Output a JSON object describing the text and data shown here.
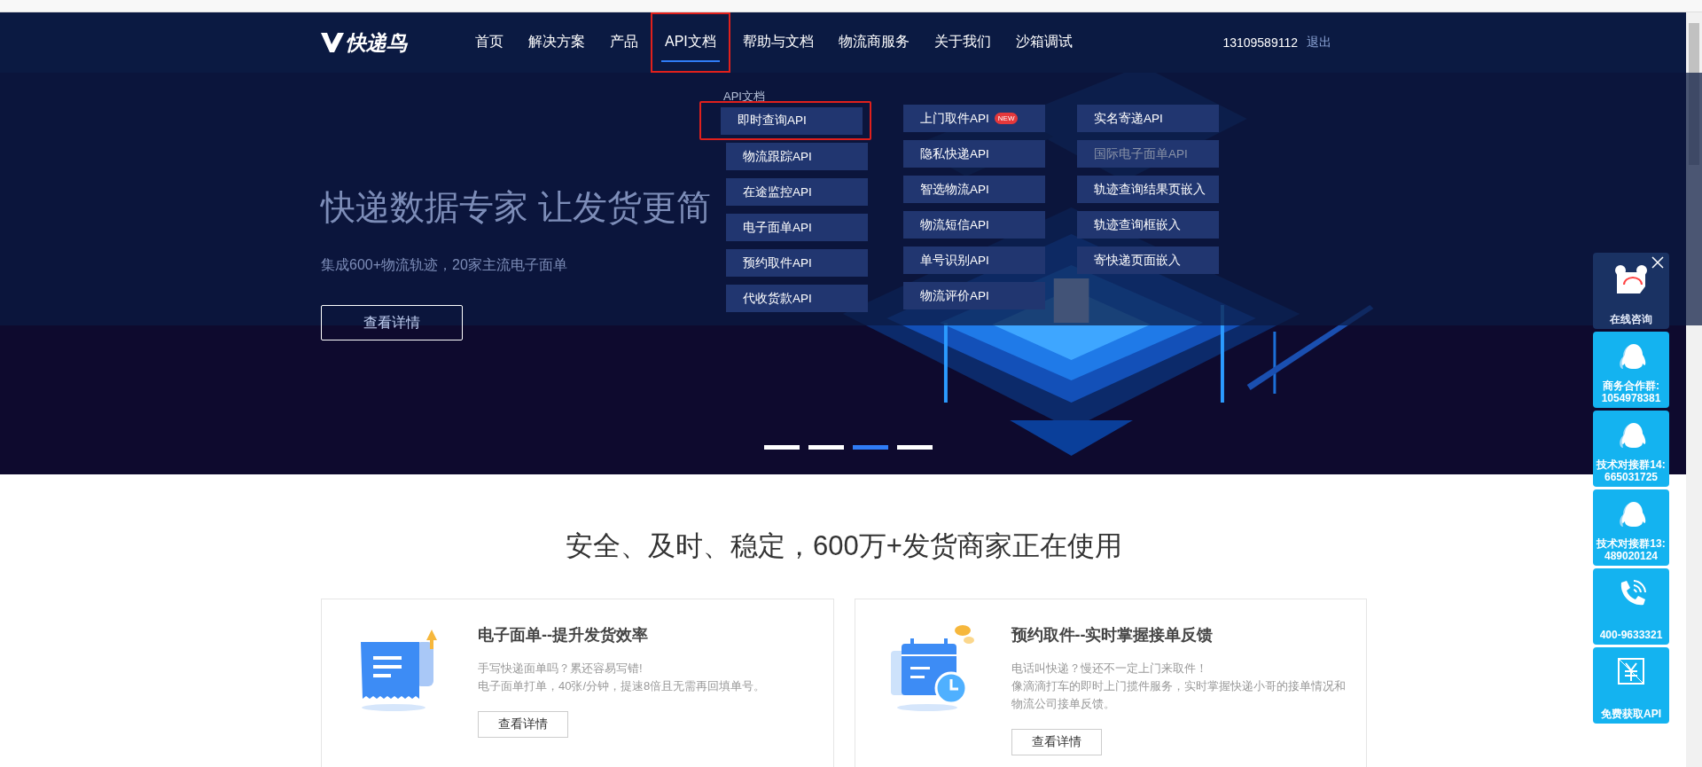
{
  "nav": {
    "logo": "快递鸟",
    "items": [
      {
        "label": "首页",
        "selected": false,
        "marked": false
      },
      {
        "label": "解决方案",
        "selected": false,
        "marked": false
      },
      {
        "label": "产品",
        "selected": false,
        "marked": false
      },
      {
        "label": "API文档",
        "selected": true,
        "marked": true
      },
      {
        "label": "帮助与文档",
        "selected": false,
        "marked": false
      },
      {
        "label": "物流商服务",
        "selected": false,
        "marked": false
      },
      {
        "label": "关于我们",
        "selected": false,
        "marked": false
      },
      {
        "label": "沙箱调试",
        "selected": false,
        "marked": false
      }
    ],
    "phone": "13109589112",
    "logout": "退出"
  },
  "api_menu": {
    "heading": "API文档",
    "columns": [
      [
        {
          "label": "即时查询API",
          "disabled": false,
          "marked": true
        },
        {
          "label": "物流跟踪API",
          "disabled": false,
          "marked": false
        },
        {
          "label": "在途监控API",
          "disabled": false,
          "marked": false
        },
        {
          "label": "电子面单API",
          "disabled": false,
          "marked": false
        },
        {
          "label": "预约取件API",
          "disabled": false,
          "marked": false
        },
        {
          "label": "代收货款API",
          "disabled": false,
          "marked": false
        }
      ],
      [
        {
          "label": "上门取件API",
          "badge": "NEW",
          "disabled": false,
          "marked": false
        },
        {
          "label": "隐私快递API",
          "disabled": false,
          "marked": false
        },
        {
          "label": "智选物流API",
          "disabled": false,
          "marked": false
        },
        {
          "label": "物流短信API",
          "disabled": false,
          "marked": false
        },
        {
          "label": "单号识别API",
          "disabled": false,
          "marked": false
        },
        {
          "label": "物流评价API",
          "disabled": false,
          "marked": false
        }
      ],
      [
        {
          "label": "实名寄递API",
          "disabled": false,
          "marked": false
        },
        {
          "label": "国际电子面单API",
          "disabled": true,
          "marked": false
        },
        {
          "label": "轨迹查询结果页嵌入",
          "disabled": false,
          "marked": false
        },
        {
          "label": "轨迹查询框嵌入",
          "disabled": false,
          "marked": false
        },
        {
          "label": "寄快递页面嵌入",
          "disabled": false,
          "marked": false
        }
      ]
    ]
  },
  "banner": {
    "headline": "快递数据专家 让发货更简",
    "subtitle": "集成600+物流轨迹，20家主流电子面单",
    "button": "查看详情",
    "slides": [
      {
        "selected": false
      },
      {
        "selected": false
      },
      {
        "selected": true
      },
      {
        "selected": false
      }
    ]
  },
  "side_widgets": [
    {
      "kind": "chat",
      "title": "在线咨询"
    },
    {
      "kind": "qq",
      "title": "商务合作群:",
      "number": "1054978381"
    },
    {
      "kind": "qq",
      "title": "技术对接群14:",
      "number": "665031725"
    },
    {
      "kind": "qq",
      "title": "技术对接群13:",
      "number": "489020124"
    },
    {
      "kind": "phone",
      "title": "400-9633321"
    },
    {
      "kind": "price",
      "title": "免费获取API"
    }
  ],
  "section": {
    "heading": "安全、及时、稳定，600万+发货商家正在使用",
    "cards": [
      {
        "kind": "waybill",
        "title": "电子面单--提升发货效率",
        "lines": [
          "手写快递面单吗？累还容易写错!",
          "电子面单打单，40张/分钟，提速8倍且无需再回填单号。"
        ],
        "button": "查看详情"
      },
      {
        "kind": "calendar",
        "title": "预约取件--实时掌握接单反馈",
        "lines": [
          "电话叫快递？慢还不一定上门来取件！",
          "像滴滴打车的即时上门揽件服务，实时掌握快递小哥的接单情况和物流公司接单反馈。"
        ],
        "button": "查看详情"
      }
    ]
  }
}
